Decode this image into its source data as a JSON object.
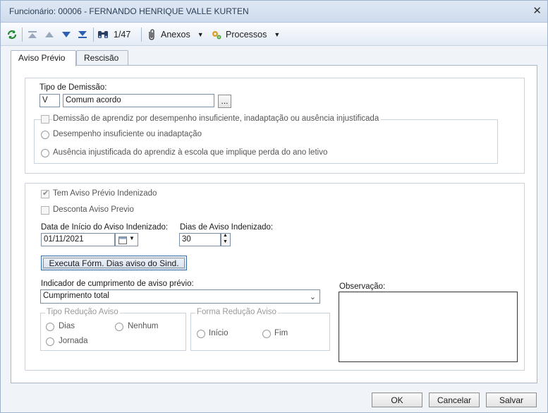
{
  "window": {
    "title": "Funcionário: 00006 - FERNANDO HENRIQUE VALLE KURTEN",
    "close_glyph": "✕"
  },
  "toolbar": {
    "record_position": "1/47",
    "attachments_label": "Anexos",
    "processes_label": "Processos"
  },
  "tabs": [
    {
      "label": "Aviso Prévio",
      "active": true
    },
    {
      "label": "Rescisão",
      "active": false
    }
  ],
  "dismissal": {
    "type_label": "Tipo de Demissão:",
    "type_code": "V",
    "type_description": "Comum acordo",
    "lookup_label": "...",
    "apprentice_label": "Demissão de aprendiz por desempenho insuficiente, inadaptação ou ausência injustificada",
    "option_performance": "Desempenho insuficiente ou inadaptação",
    "option_absence": "Ausência injustificada do aprendiz à escola que implique perda do ano letivo"
  },
  "notice": {
    "indemnified_label": "Tem Aviso Prévio Indenizado",
    "indemnified_checked": true,
    "discount_label": "Desconta Aviso Previo",
    "discount_checked": false,
    "start_date_label": "Data de Início do Aviso Indenizado:",
    "start_date_value": "01/11/2021",
    "days_label": "Dias de Aviso Indenizado:",
    "days_value": "30",
    "execute_button": "Executa Fórm. Dias aviso do Sind.",
    "fulfillment_label": "Indicador de cumprimento de aviso prévio:",
    "fulfillment_value": "Cumprimento total",
    "observation_label": "Observação:",
    "reduction_type_legend": "Tipo Redução Aviso",
    "reduction_days": "Dias",
    "reduction_none": "Nenhum",
    "reduction_journey": "Jornada",
    "reduction_form_legend": "Forma Redução Aviso",
    "reduction_start": "Início",
    "reduction_end": "Fim"
  },
  "footer": {
    "ok": "OK",
    "cancel": "Cancelar",
    "save": "Salvar"
  },
  "icons": [
    "refresh-icon",
    "first-record-icon",
    "previous-record-icon",
    "next-record-icon",
    "last-record-icon",
    "binoculars-icon",
    "paperclip-icon",
    "processes-icon",
    "calendar-icon"
  ]
}
